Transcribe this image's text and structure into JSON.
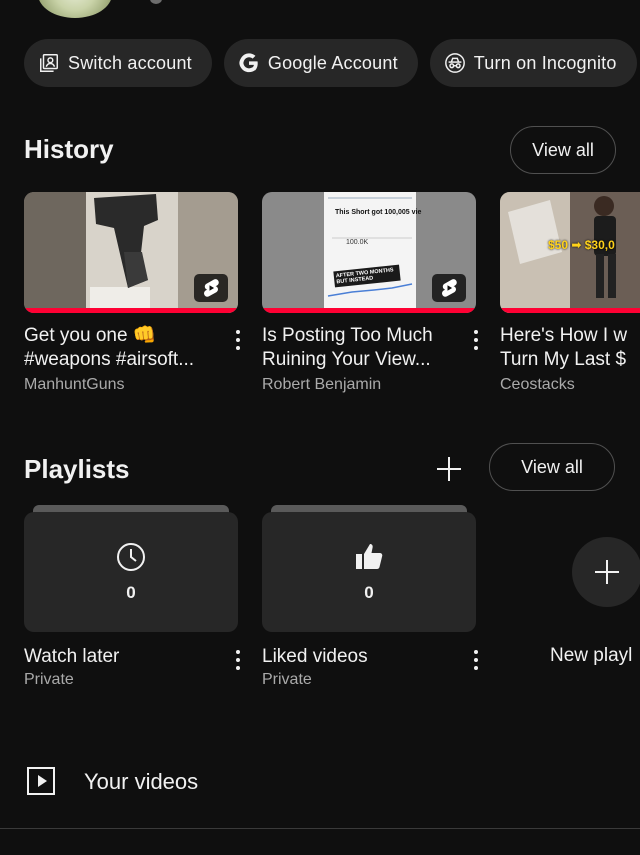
{
  "accounts": {
    "chips": [
      {
        "label": "Switch account",
        "icon": "switch-account-icon"
      },
      {
        "label": "Google Account",
        "icon": "google-g-icon"
      },
      {
        "label": "Turn on Incognito",
        "icon": "incognito-icon"
      }
    ]
  },
  "history": {
    "title": "History",
    "view_all": "View all",
    "videos": [
      {
        "title_line1": "Get you one 👊",
        "title_line2": "#weapons #airsoft...",
        "channel": "ManhuntGuns",
        "thumb_text": ""
      },
      {
        "title_line1": "Is Posting Too Much",
        "title_line2": "Ruining Your View...",
        "channel": "Robert Benjamin",
        "thumb_text": "This Short got 100,005 vie",
        "thumb_value": "100.0K",
        "thumb_caption": "AFTER TWO MONTHS BUT INSTEAD"
      },
      {
        "title_line1": "Here's How I w",
        "title_line2": "Turn My Last $",
        "channel": "Ceostacks",
        "thumb_text": "$50 ➡ $30,0"
      }
    ]
  },
  "playlists": {
    "title": "Playlists",
    "view_all": "View all",
    "items": [
      {
        "name": "Watch later",
        "privacy": "Private",
        "count": "0",
        "icon": "clock-icon"
      },
      {
        "name": "Liked videos",
        "privacy": "Private",
        "count": "0",
        "icon": "thumbs-up-icon"
      }
    ],
    "new_label": "New playl"
  },
  "your_videos": {
    "label": "Your videos"
  },
  "colors": {
    "background": "#0f0f0f",
    "chip": "#272727",
    "progress": "#ff0033",
    "secondary_text": "#aaaaaa"
  }
}
